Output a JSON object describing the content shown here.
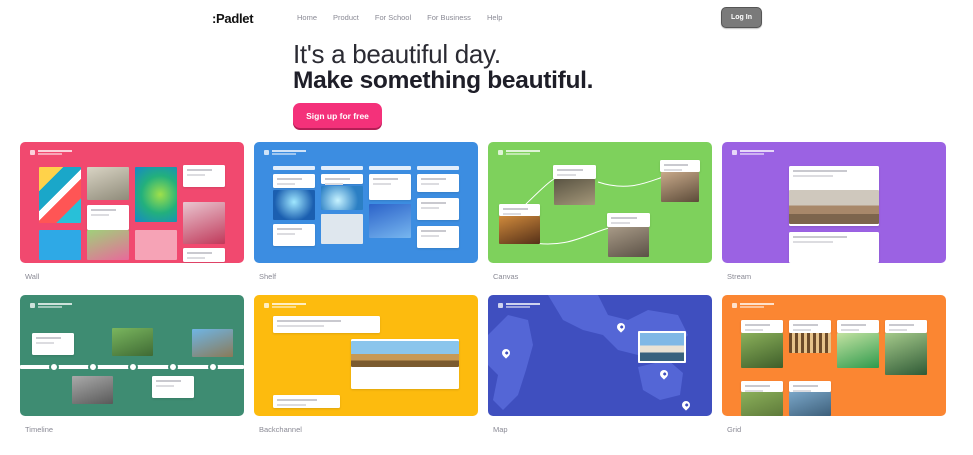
{
  "nav": {
    "logo": ":Padlet",
    "links": [
      "Home",
      "Product",
      "For School",
      "For Business",
      "Help"
    ],
    "login_label": "Log In"
  },
  "hero": {
    "line1": "It's a beautiful day.",
    "line2": "Make something beautiful.",
    "signup_label": "Sign up for free"
  },
  "formats": [
    {
      "label": "Wall",
      "color": "#f1496f"
    },
    {
      "label": "Shelf",
      "color": "#3c8de1"
    },
    {
      "label": "Canvas",
      "color": "#7ed15c"
    },
    {
      "label": "Stream",
      "color": "#9b62e3"
    },
    {
      "label": "Timeline",
      "color": "#3e8c72"
    },
    {
      "label": "Backchannel",
      "color": "#fdbb0e"
    },
    {
      "label": "Map",
      "color": "#3f4fbf"
    },
    {
      "label": "Grid",
      "color": "#fb8632"
    }
  ],
  "colors": {
    "brand_pink": "#f4317a",
    "login_gray": "#7a7a7a"
  }
}
